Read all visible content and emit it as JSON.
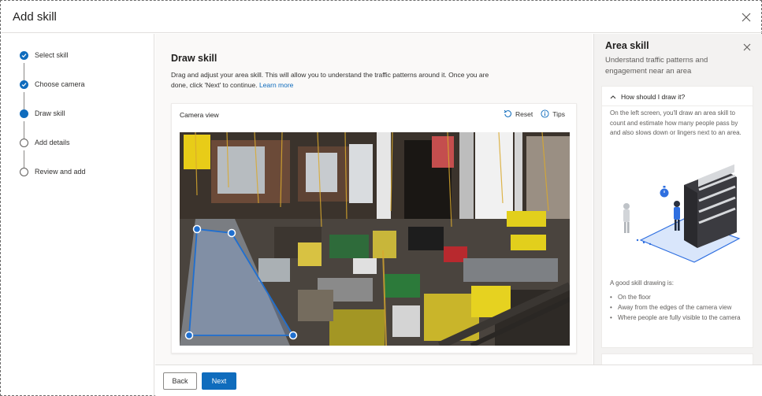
{
  "dialog": {
    "title": "Add skill"
  },
  "steps": [
    {
      "label": "Select skill",
      "state": "done"
    },
    {
      "label": "Choose camera",
      "state": "done"
    },
    {
      "label": "Draw skill",
      "state": "current"
    },
    {
      "label": "Add details",
      "state": "todo"
    },
    {
      "label": "Review and add",
      "state": "todo"
    }
  ],
  "main": {
    "title": "Draw skill",
    "description": "Drag and adjust your area skill. This will allow you to understand the traffic patterns around it. Once you are done, click 'Next' to continue.",
    "learn_more": "Learn more",
    "card_title": "Camera view",
    "reset_label": "Reset",
    "tips_label": "Tips"
  },
  "footer": {
    "back_label": "Back",
    "next_label": "Next"
  },
  "panel": {
    "title": "Area skill",
    "subtitle": "Understand traffic patterns and engagement near an area",
    "question": "How should I draw it?",
    "body": "On the left screen, you'll draw an area skill to count and estimate how many people pass by and also slows down or lingers next to an area.",
    "good_heading": "A good skill drawing is:",
    "bullets": [
      "On the floor",
      "Away from the edges of the camera view",
      "Where people are fully visible to the camera"
    ]
  },
  "colors": {
    "accent": "#0f6cbd",
    "polygon_fill": "#8fb3e8"
  }
}
